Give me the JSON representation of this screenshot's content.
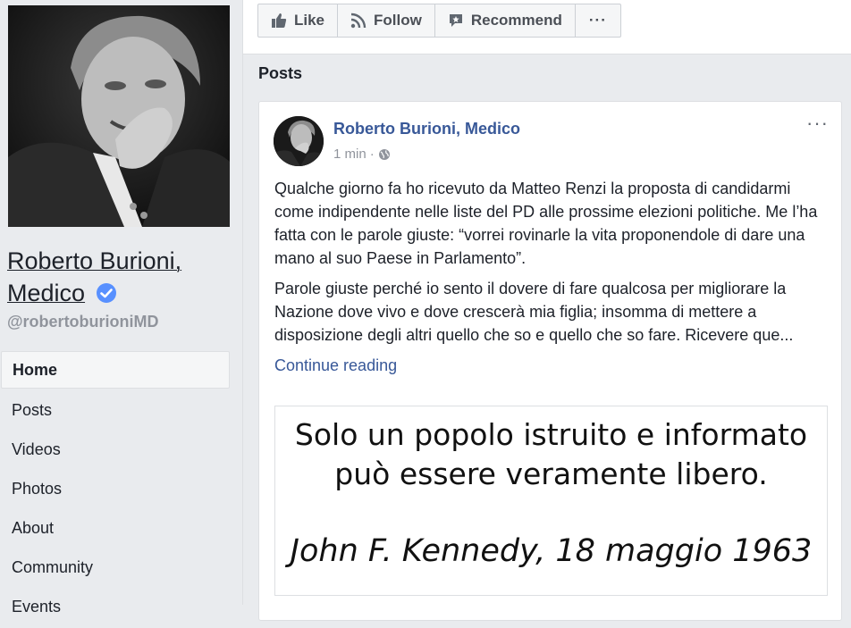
{
  "profile": {
    "name": "Roberto Burioni, Medico",
    "name_line1": "Roberto Burioni,",
    "name_line2": "Medico",
    "handle": "@robertoburioniMD",
    "verified_color": "#5890ff"
  },
  "nav": {
    "items": [
      {
        "label": "Home",
        "active": true
      },
      {
        "label": "Posts"
      },
      {
        "label": "Videos"
      },
      {
        "label": "Photos"
      },
      {
        "label": "About"
      },
      {
        "label": "Community"
      },
      {
        "label": "Events"
      }
    ]
  },
  "actions": {
    "like": "Like",
    "follow": "Follow",
    "recommend": "Recommend",
    "more": "···"
  },
  "section_title": "Posts",
  "post": {
    "author": "Roberto Burioni, Medico",
    "time": "1 min",
    "separator": "·",
    "options": "···",
    "paragraph1": "Qualche giorno fa ho ricevuto da Matteo Renzi la proposta di candidarmi come indipendente nelle liste del PD alle prossime elezioni politiche. Me l’ha fatta con le parole giuste: “vorrei rovinarle la vita proponendole di dare una mano al suo Paese in Parlamento”.",
    "paragraph2": "Parole giuste perché io sento il dovere di fare qualcosa per migliorare la Nazione dove vivo e dove crescerà mia figlia; insomma di mettere a disposizione degli altri quello che so e quello che so fare. Ricevere que...",
    "continue_label": "Continue reading",
    "image": {
      "line1": "Solo un popolo istruito e informato",
      "line2": "può essere veramente libero.",
      "line3": "John F. Kennedy,  18 maggio 1963"
    }
  },
  "colors": {
    "link": "#385898",
    "background": "#e9ebee",
    "muted": "#90949c"
  }
}
